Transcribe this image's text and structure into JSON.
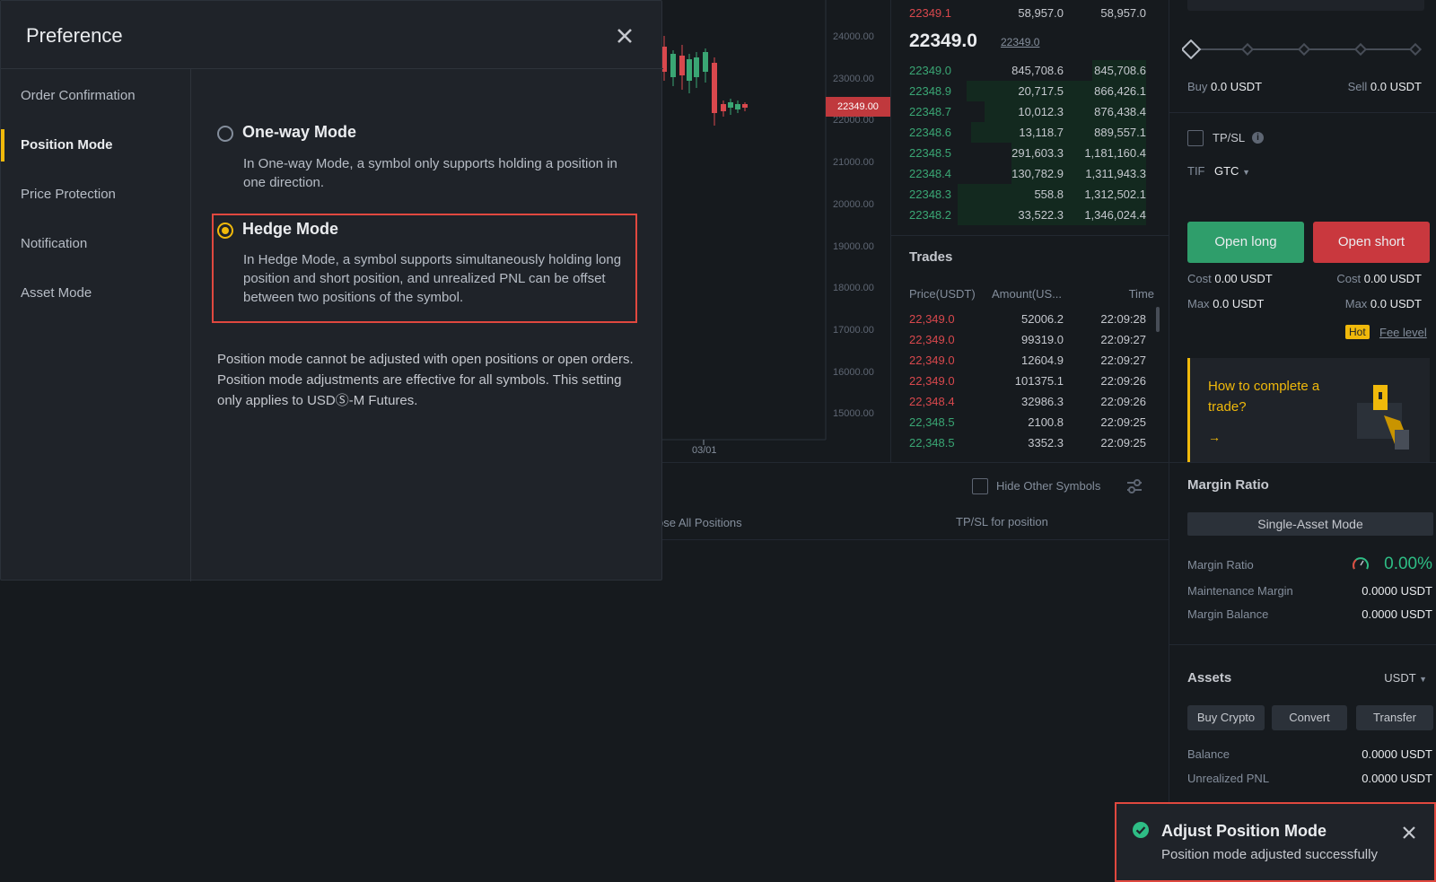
{
  "chart": {
    "price_axis": [
      "24000.00",
      "23000.00",
      "22000.00",
      "21000.00",
      "20000.00",
      "19000.00",
      "18000.00",
      "17000.00",
      "16000.00",
      "15000.00"
    ],
    "current_price_tag": "22349.00",
    "date_label": "03/01"
  },
  "orderbook": {
    "top_ask": {
      "price": "22349.1",
      "amount": "58,957.0",
      "total": "58,957.0"
    },
    "last_price": "22349.0",
    "mark_price": "22349.0",
    "bids": [
      {
        "price": "22349.0",
        "amount": "845,708.6",
        "total": "845,708.6"
      },
      {
        "price": "22348.9",
        "amount": "20,717.5",
        "total": "866,426.1"
      },
      {
        "price": "22348.7",
        "amount": "10,012.3",
        "total": "876,438.4"
      },
      {
        "price": "22348.6",
        "amount": "13,118.7",
        "total": "889,557.1"
      },
      {
        "price": "22348.5",
        "amount": "291,603.3",
        "total": "1,181,160.4"
      },
      {
        "price": "22348.4",
        "amount": "130,782.9",
        "total": "1,311,943.3"
      },
      {
        "price": "22348.3",
        "amount": "558.8",
        "total": "1,312,502.1"
      },
      {
        "price": "22348.2",
        "amount": "33,522.3",
        "total": "1,346,024.4"
      }
    ]
  },
  "trades": {
    "title": "Trades",
    "headers": {
      "price": "Price(USDT)",
      "amount": "Amount(US...",
      "time": "Time"
    },
    "rows": [
      {
        "price": "22,349.0",
        "amount": "52006.2",
        "time": "22:09:28",
        "side": "sell"
      },
      {
        "price": "22,349.0",
        "amount": "99319.0",
        "time": "22:09:27",
        "side": "sell"
      },
      {
        "price": "22,349.0",
        "amount": "12604.9",
        "time": "22:09:27",
        "side": "sell"
      },
      {
        "price": "22,349.0",
        "amount": "101375.1",
        "time": "22:09:26",
        "side": "sell"
      },
      {
        "price": "22,348.4",
        "amount": "32986.3",
        "time": "22:09:26",
        "side": "sell"
      },
      {
        "price": "22,348.5",
        "amount": "2100.8",
        "time": "22:09:25",
        "side": "buy"
      },
      {
        "price": "22,348.5",
        "amount": "3352.3",
        "time": "22:09:25",
        "side": "buy"
      }
    ]
  },
  "order_form": {
    "buy_label": "Buy",
    "buy_value": "0.0 USDT",
    "sell_label": "Sell",
    "sell_value": "0.0 USDT",
    "tpsl_label": "TP/SL",
    "tif_label": "TIF",
    "tif_value": "GTC",
    "open_long": "Open long",
    "open_short": "Open short",
    "cost_label": "Cost",
    "cost_long": "0.00 USDT",
    "cost_short": "0.00 USDT",
    "max_label": "Max",
    "max_long": "0.0 USDT",
    "max_short": "0.0 USDT",
    "hot_badge": "Hot",
    "fee_level": "Fee level",
    "promo_text": "How to complete a trade?",
    "promo_arrow": "→"
  },
  "margin": {
    "title": "Margin Ratio",
    "mode_button": "Single-Asset Mode",
    "ratio_label": "Margin Ratio",
    "ratio_value": "0.00%",
    "maint_label": "Maintenance Margin",
    "maint_value": "0.0000 USDT",
    "balance_label": "Margin Balance",
    "balance_value": "0.0000 USDT"
  },
  "assets": {
    "title": "Assets",
    "currency": "USDT",
    "buttons": [
      "Buy Crypto",
      "Convert",
      "Transfer"
    ],
    "balance_label": "Balance",
    "balance_value": "0.0000 USDT",
    "pnl_label": "Unrealized PNL",
    "pnl_value": "0.0000 USDT"
  },
  "positions_bar": {
    "hide_other": "Hide Other Symbols",
    "close_all": "ose All Positions",
    "tpsl_position": "TP/SL for position"
  },
  "modal": {
    "title": "Preference",
    "nav": [
      "Order Confirmation",
      "Position Mode",
      "Price Protection",
      "Notification",
      "Asset Mode"
    ],
    "active_nav": "Position Mode",
    "one_way_title": "One-way Mode",
    "one_way_desc": "In One-way Mode, a symbol only supports holding a position in one direction.",
    "hedge_title": "Hedge Mode",
    "hedge_desc": "In Hedge Mode, a symbol supports simultaneously holding long position and short position, and unrealized PNL can be offset between two positions of the symbol.",
    "note": "Position mode cannot be adjusted with open positions or open orders. Position mode adjustments are effective for all symbols. This setting only applies to USDⓈ-M Futures.",
    "selected": "hedge"
  },
  "toast": {
    "title": "Adjust Position Mode",
    "message": "Position mode adjusted successfully"
  },
  "colors": {
    "accent": "#f0b90b",
    "buy": "#2ebd85",
    "sell": "#f6465d",
    "highlight": "#e0483f"
  }
}
